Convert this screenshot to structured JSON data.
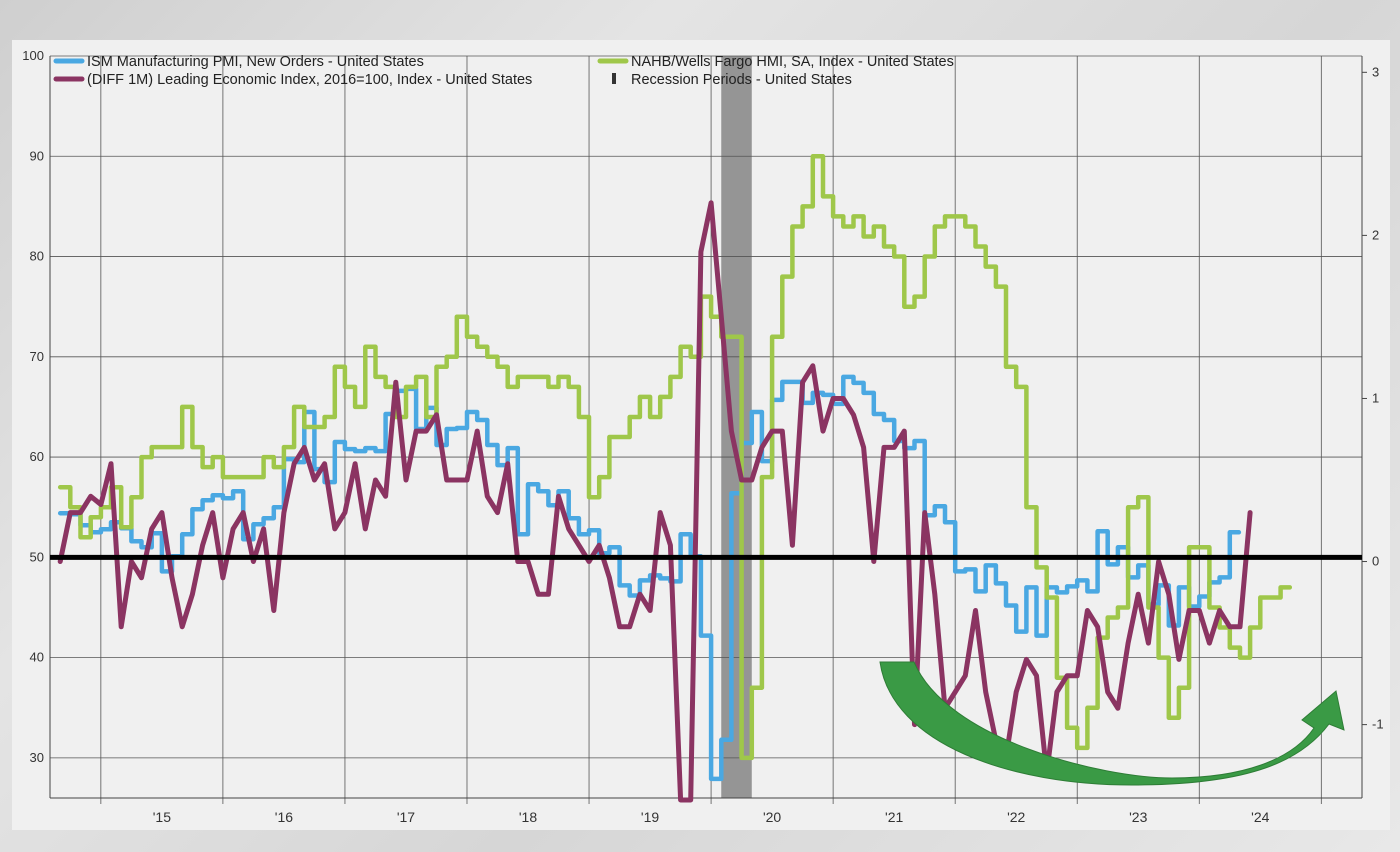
{
  "chart_data": {
    "type": "line",
    "title": "",
    "xlabel": "",
    "ylabel": "",
    "x_ticks": [
      "'15",
      "'16",
      "'17",
      "'18",
      "'19",
      "'20",
      "'21",
      "'22",
      "'23",
      "'24"
    ],
    "x_range": [
      "2014-08",
      "2025-05"
    ],
    "left_axis": {
      "ylim": [
        26,
        100
      ],
      "ticks": [
        30,
        40,
        50,
        60,
        70,
        80,
        90,
        100
      ]
    },
    "right_axis": {
      "ylim": [
        -1.45,
        3.1
      ],
      "ticks": [
        -1,
        0,
        1,
        2,
        3
      ]
    },
    "reference_line": {
      "axis": "left",
      "value": 50
    },
    "grid": true,
    "legend_position": "top-left",
    "legend": [
      {
        "label": "ISM Manufacturing PMI, New Orders - United States",
        "color": "#4aa8e2",
        "marker": "line"
      },
      {
        "label": "NAHB/Wells Fargo HMI, SA, Index - United States",
        "color": "#9fc74a",
        "marker": "line"
      },
      {
        "label": "(DIFF 1M) Leading Economic Index, 2016=100, Index - United States",
        "color": "#8b3462",
        "marker": "line"
      },
      {
        "label": "Recession Periods - United States",
        "color": "#6e6e6e",
        "marker": "bar"
      }
    ],
    "recession_periods": [
      {
        "start": "2020-02",
        "end": "2020-04"
      }
    ],
    "annotation_arrow": {
      "description": "green curved upward arrow",
      "color": "#3a9a45"
    },
    "series": [
      {
        "name": "ISM Manufacturing PMI, New Orders - United States",
        "axis": "left",
        "color": "#4aa8e2",
        "start": "2014-09",
        "values": [
          54.4,
          54.3,
          53.2,
          52.5,
          52.8,
          53.5,
          52.9,
          51.6,
          51,
          52.4,
          48.6,
          50.1,
          52.3,
          54.8,
          55.7,
          56.2,
          55.9,
          56.6,
          51.8,
          53.3,
          53.9,
          55,
          59.8,
          59.5,
          64.5,
          58.8,
          57.5,
          61.5,
          60.8,
          60.6,
          60.9,
          60.6,
          64.3,
          66.6,
          66.8,
          62.8,
          64.9,
          61.2,
          62.8,
          62.9,
          64.5,
          63.7,
          61.2,
          59.2,
          60.9,
          52.3,
          57.3,
          56.6,
          55.2,
          56.6,
          53.9,
          52.3,
          52.7,
          50.4,
          51,
          47.2,
          46.2,
          47.7,
          48.2,
          47.9,
          47.6,
          52.3,
          50.1,
          42.2,
          27.9,
          31.8,
          56.4,
          61.4,
          64.5,
          59.6,
          65.7,
          67.5,
          67.5,
          65.4,
          66.4,
          66.2,
          65.3,
          68,
          67.4,
          66.4,
          64.3,
          63.7,
          61.6,
          60.9,
          61.6,
          54.2,
          55.1,
          53.5,
          48.6,
          48.8,
          46.6,
          49.2,
          47.4,
          45.2,
          42.6,
          47,
          42.2,
          47,
          46.5,
          47.1,
          47.7,
          46.6,
          52.6,
          49.3,
          51,
          48,
          49.2,
          45.3,
          47.2,
          43.2,
          47,
          45.1,
          46.1,
          47.5,
          48,
          52.5
        ],
        "note": "ISM PMI new orders"
      },
      {
        "name": "NAHB/Wells Fargo HMI, SA, Index - United States",
        "axis": "left",
        "color": "#9fc74a",
        "start": "2014-09",
        "values": [
          57,
          55,
          52,
          54,
          55,
          57,
          53,
          56,
          60,
          61,
          61,
          61,
          65,
          61,
          59,
          60,
          58,
          58,
          58,
          58,
          60,
          59,
          61,
          65,
          63,
          63,
          64,
          69,
          67,
          65,
          71,
          68,
          67,
          64,
          67,
          68,
          64,
          69,
          70,
          74,
          72,
          71,
          70,
          69,
          67,
          68,
          68,
          68,
          67,
          68,
          67,
          64,
          56,
          58,
          62,
          62,
          64,
          66,
          64,
          66,
          68,
          71,
          70,
          76,
          74,
          72,
          72,
          30,
          37,
          58,
          72,
          78,
          83,
          85,
          90,
          86,
          84,
          83,
          84,
          82,
          83,
          81,
          80,
          75,
          76,
          80,
          83,
          84,
          84,
          83,
          81,
          79,
          77,
          69,
          67,
          55,
          49,
          46,
          38,
          33,
          31,
          35,
          42,
          44,
          45,
          55,
          56,
          45,
          40,
          34,
          37,
          51,
          51,
          45,
          43,
          41,
          40,
          43,
          46,
          46,
          47
        ],
        "note": "NAHB HMI"
      },
      {
        "name": "(DIFF 1M) Leading Economic Index, 2016=100, Index - United States",
        "axis": "right",
        "color": "#8b3462",
        "start": "2014-09",
        "values": [
          0,
          0.3,
          0.3,
          0.4,
          0.35,
          0.6,
          -0.4,
          0,
          -0.1,
          0.2,
          0.3,
          -0.1,
          -0.4,
          -0.2,
          0.1,
          0.3,
          -0.1,
          0.2,
          0.3,
          0,
          0.2,
          -0.3,
          0.3,
          0.6,
          0.7,
          0.5,
          0.6,
          0.2,
          0.3,
          0.6,
          0.2,
          0.5,
          0.4,
          1.1,
          0.5,
          0.8,
          0.8,
          0.9,
          0.5,
          0.5,
          0.5,
          0.8,
          0.4,
          0.3,
          0.6,
          0,
          0,
          -0.2,
          -0.2,
          0.4,
          0.2,
          0.1,
          0,
          0.1,
          -0.1,
          -0.4,
          -0.4,
          -0.2,
          -0.3,
          0.3,
          0.1,
          -1.5,
          -7.5,
          1.9,
          2.2,
          1.5,
          0.8,
          0.5,
          0.5,
          0.7,
          0.8,
          0.8,
          0.1,
          1.1,
          1.2,
          0.8,
          1,
          1,
          0.9,
          0.7,
          0,
          0.7,
          0.7,
          0.8,
          -1,
          0.3,
          -0.2,
          -0.9,
          -0.8,
          -0.7,
          -0.3,
          -0.8,
          -1.1,
          -1.2,
          -0.8,
          -0.6,
          -0.7,
          -1.3,
          -0.8,
          -0.7,
          -0.7,
          -0.3,
          -0.4,
          -0.8,
          -0.9,
          -0.5,
          -0.2,
          -0.5,
          0,
          -0.2,
          -0.6,
          -0.3,
          -0.3,
          -0.5,
          -0.3,
          -0.4,
          -0.4,
          0.3
        ],
        "note": "LEI monthly change"
      }
    ]
  }
}
